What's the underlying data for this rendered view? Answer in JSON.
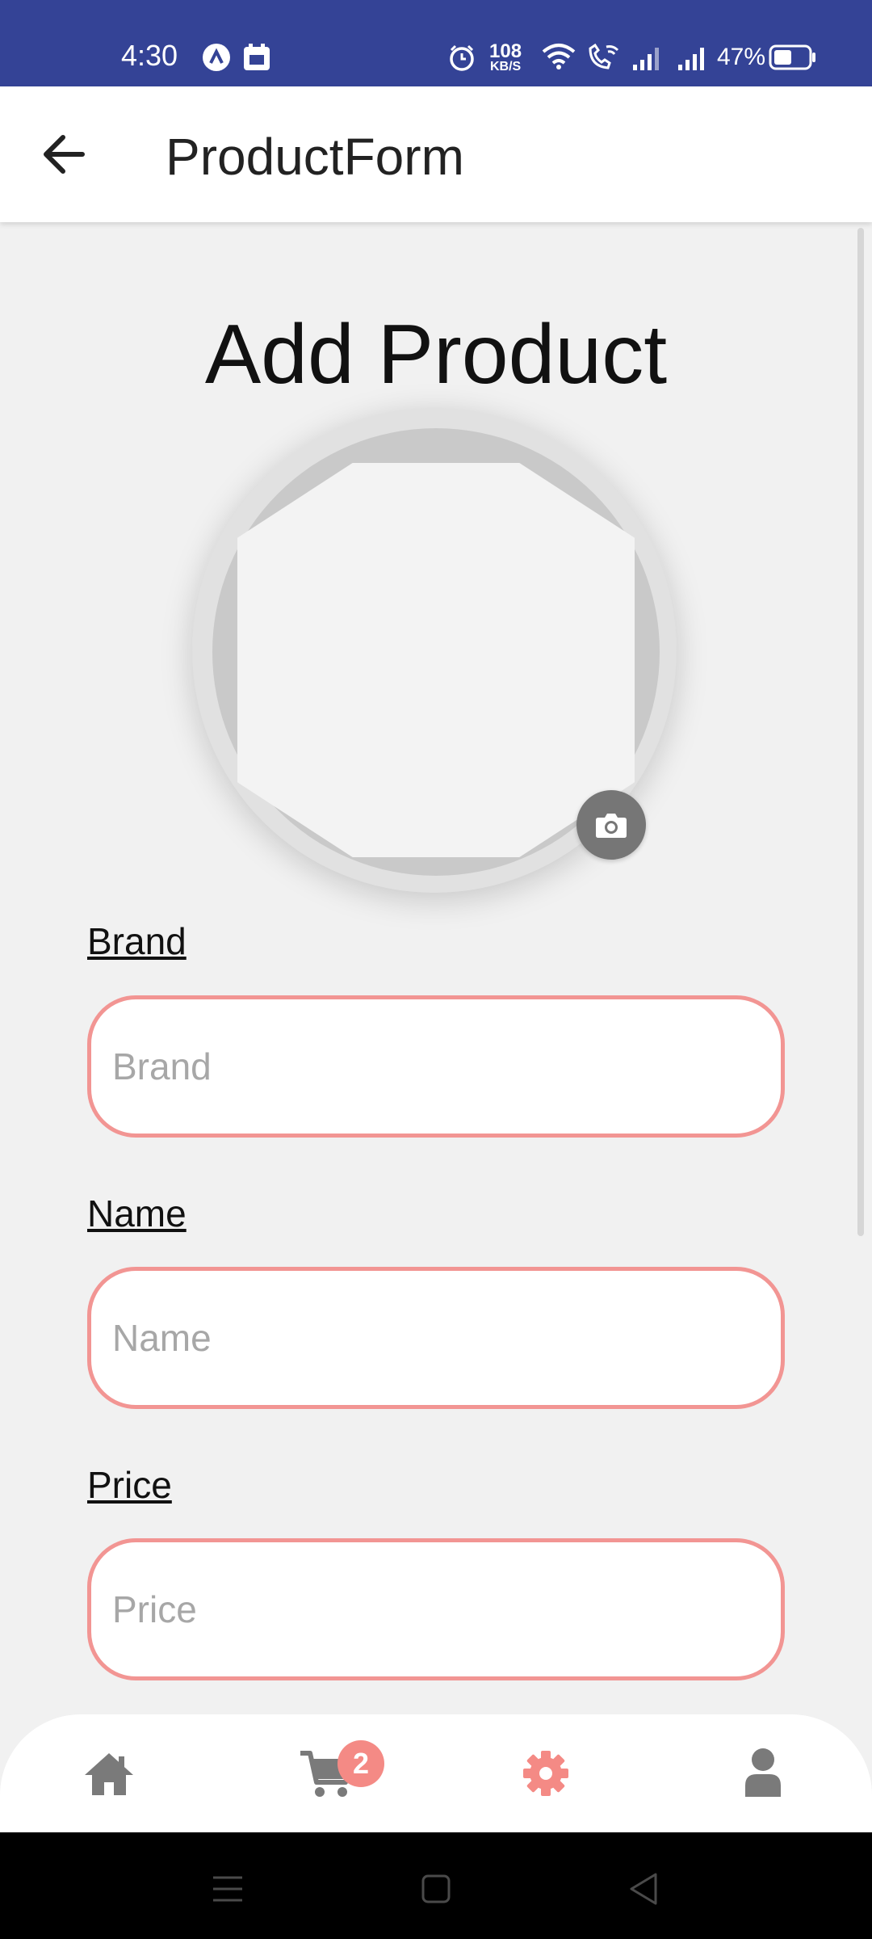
{
  "status_bar": {
    "time": "4:30",
    "net_speed_value": "108",
    "net_speed_unit": "KB/S",
    "battery": "47%",
    "bg_color": "#344396"
  },
  "app_bar": {
    "title": "ProductForm",
    "back_icon": "arrow-left-icon"
  },
  "page": {
    "heading": "Add Product"
  },
  "image_picker": {
    "camera_icon": "camera-icon"
  },
  "form": {
    "fields": [
      {
        "label": "Brand",
        "placeholder": "Brand",
        "value": ""
      },
      {
        "label": "Name",
        "placeholder": "Name",
        "value": ""
      },
      {
        "label": "Price",
        "placeholder": "Price",
        "value": ""
      }
    ],
    "border_color": "#f29593"
  },
  "bottom_nav": {
    "items": [
      {
        "icon": "home-icon",
        "active": false
      },
      {
        "icon": "cart-icon",
        "active": false,
        "badge": "2"
      },
      {
        "icon": "gear-icon",
        "active": true
      },
      {
        "icon": "user-icon",
        "active": false
      }
    ],
    "active_color": "#f48a85",
    "inactive_color": "#7a7a7a"
  },
  "system_nav": {
    "items": [
      "menu-icon",
      "home-square-icon",
      "back-triangle-icon"
    ]
  }
}
